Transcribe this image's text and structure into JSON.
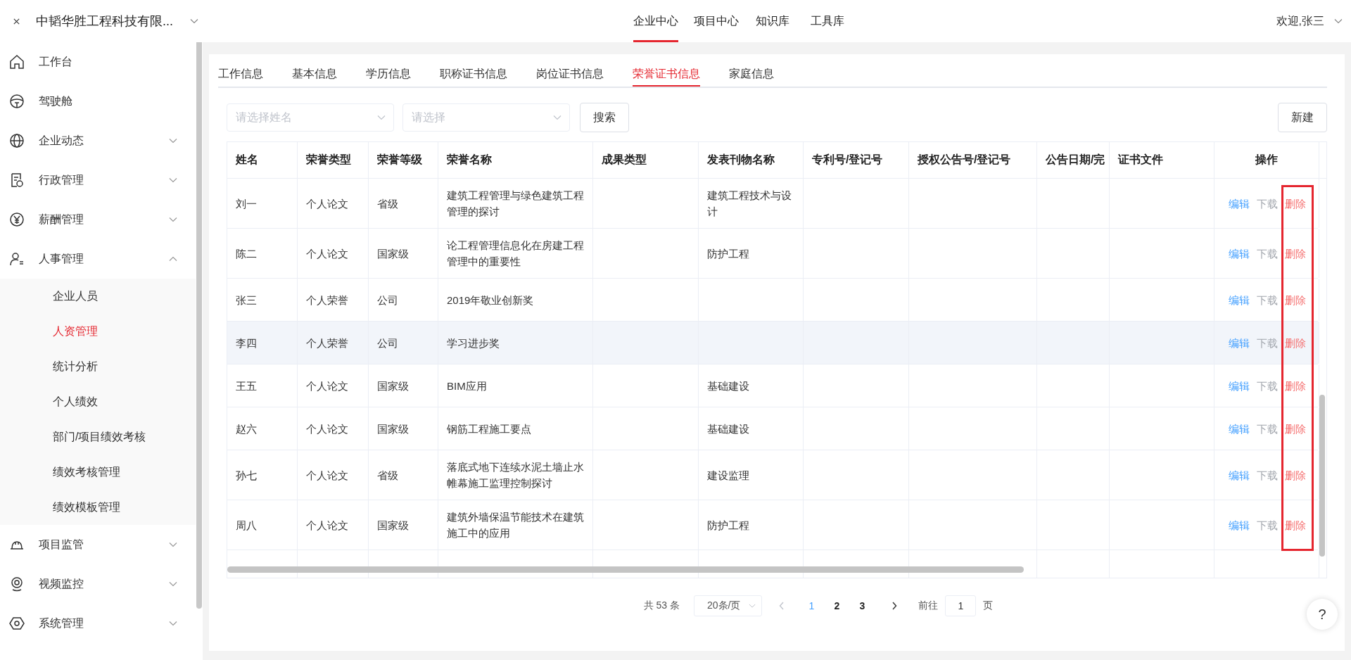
{
  "header": {
    "company": "中韬华胜工程科技有限...",
    "nav": [
      {
        "label": "企业中心",
        "selected": true
      },
      {
        "label": "项目中心",
        "selected": false
      },
      {
        "label": "知识库",
        "selected": false
      },
      {
        "label": "工具库",
        "selected": false
      }
    ],
    "user": "欢迎,张三"
  },
  "sidebar": {
    "items": [
      {
        "label": "工作台",
        "kind": "link"
      },
      {
        "label": "驾驶舱",
        "kind": "link"
      },
      {
        "label": "企业动态",
        "kind": "group",
        "expanded": false
      },
      {
        "label": "行政管理",
        "kind": "group",
        "expanded": false
      },
      {
        "label": "薪酬管理",
        "kind": "group",
        "expanded": false
      },
      {
        "label": "人事管理",
        "kind": "group",
        "expanded": true,
        "children": [
          {
            "label": "企业人员",
            "selected": false
          },
          {
            "label": "人资管理",
            "selected": true
          },
          {
            "label": "统计分析",
            "selected": false
          },
          {
            "label": "个人绩效",
            "selected": false
          },
          {
            "label": "部门/项目绩效考核",
            "selected": false
          },
          {
            "label": "绩效考核管理",
            "selected": false
          },
          {
            "label": "绩效模板管理",
            "selected": false
          }
        ]
      },
      {
        "label": "项目监管",
        "kind": "group",
        "expanded": false
      },
      {
        "label": "视频监控",
        "kind": "group",
        "expanded": false
      },
      {
        "label": "系统管理",
        "kind": "group",
        "expanded": false
      }
    ]
  },
  "tabs": [
    {
      "label": "工作信息",
      "selected": false
    },
    {
      "label": "基本信息",
      "selected": false
    },
    {
      "label": "学历信息",
      "selected": false
    },
    {
      "label": "职称证书信息",
      "selected": false
    },
    {
      "label": "岗位证书信息",
      "selected": false
    },
    {
      "label": "荣誉证书信息",
      "selected": true
    },
    {
      "label": "家庭信息",
      "selected": false
    }
  ],
  "filters": [
    {
      "placeholder": "请选择姓名"
    },
    {
      "placeholder": "请选择"
    }
  ],
  "search_button": "搜索",
  "new_button": "新建",
  "table": {
    "columns": [
      "姓名",
      "荣誉类型",
      "荣誉等级",
      "荣誉名称",
      "成果类型",
      "发表刊物名称",
      "专利号/登记号",
      "授权公告号/登记号",
      "公告日期/完"
    ],
    "fixed_columns": [
      "证书文件",
      "操作"
    ],
    "rows": [
      {
        "cells": [
          "刘一",
          "个人论文",
          "省级",
          "建筑工程管理与绿色建筑工程管理的探讨",
          "",
          "建筑工程技术与设计",
          "",
          "",
          ""
        ],
        "highlighted": false,
        "actions": [
          {
            "label": "编辑",
            "kind": "edit",
            "disabled": false
          },
          {
            "label": "下载",
            "kind": "download",
            "disabled": true
          },
          {
            "label": "删除",
            "kind": "delete",
            "disabled": false
          }
        ]
      },
      {
        "cells": [
          "陈二",
          "个人论文",
          "国家级",
          "论工程管理信息化在房建工程管理中的重要性",
          "",
          "防护工程",
          "",
          "",
          ""
        ],
        "highlighted": false,
        "actions": [
          {
            "label": "编辑",
            "kind": "edit",
            "disabled": false
          },
          {
            "label": "下载",
            "kind": "download",
            "disabled": true
          },
          {
            "label": "删除",
            "kind": "delete",
            "disabled": false
          }
        ]
      },
      {
        "cells": [
          "张三",
          "个人荣誉",
          "公司",
          "2019年敬业创新奖",
          "",
          "",
          "",
          "",
          ""
        ],
        "highlighted": false,
        "actions": [
          {
            "label": "编辑",
            "kind": "edit",
            "disabled": false
          },
          {
            "label": "下载",
            "kind": "download",
            "disabled": true
          },
          {
            "label": "删除",
            "kind": "delete",
            "disabled": false
          }
        ]
      },
      {
        "cells": [
          "李四",
          "个人荣誉",
          "公司",
          "学习进步奖",
          "",
          "",
          "",
          "",
          ""
        ],
        "highlighted": true,
        "actions": [
          {
            "label": "编辑",
            "kind": "edit",
            "disabled": false
          },
          {
            "label": "下载",
            "kind": "download",
            "disabled": true
          },
          {
            "label": "删除",
            "kind": "delete",
            "disabled": false
          }
        ]
      },
      {
        "cells": [
          "王五",
          "个人论文",
          "国家级",
          "BIM应用",
          "",
          "基础建设",
          "",
          "",
          ""
        ],
        "highlighted": false,
        "actions": [
          {
            "label": "编辑",
            "kind": "edit",
            "disabled": false
          },
          {
            "label": "下载",
            "kind": "download",
            "disabled": true
          },
          {
            "label": "删除",
            "kind": "delete",
            "disabled": false
          }
        ]
      },
      {
        "cells": [
          "赵六",
          "个人论文",
          "国家级",
          "钢筋工程施工要点",
          "",
          "基础建设",
          "",
          "",
          ""
        ],
        "highlighted": false,
        "actions": [
          {
            "label": "编辑",
            "kind": "edit",
            "disabled": false
          },
          {
            "label": "下载",
            "kind": "download",
            "disabled": true
          },
          {
            "label": "删除",
            "kind": "delete",
            "disabled": false
          }
        ]
      },
      {
        "cells": [
          "孙七",
          "个人论文",
          "省级",
          "落底式地下连续水泥土墙止水帷幕施工监理控制探讨",
          "",
          "建设监理",
          "",
          "",
          ""
        ],
        "highlighted": false,
        "actions": [
          {
            "label": "编辑",
            "kind": "edit",
            "disabled": false
          },
          {
            "label": "下载",
            "kind": "download",
            "disabled": true
          },
          {
            "label": "删除",
            "kind": "delete",
            "disabled": false
          }
        ]
      },
      {
        "cells": [
          "周八",
          "个人论文",
          "国家级",
          "建筑外墙保温节能技术在建筑施工中的应用",
          "",
          "防护工程",
          "",
          "",
          ""
        ],
        "highlighted": false,
        "actions": [
          {
            "label": "编辑",
            "kind": "edit",
            "disabled": false
          },
          {
            "label": "下载",
            "kind": "download",
            "disabled": true
          },
          {
            "label": "删除",
            "kind": "delete",
            "disabled": false
          }
        ]
      }
    ],
    "highlight_frame": true
  },
  "pagination": {
    "total": "共 53 条",
    "page_size": "20条/页",
    "pages": [
      {
        "label": "1",
        "selected": true
      },
      {
        "label": "2",
        "selected": false
      },
      {
        "label": "3",
        "selected": false
      }
    ],
    "goto_label": "前往",
    "goto_value": "1",
    "goto_suffix": "页"
  },
  "help_button": "?"
}
